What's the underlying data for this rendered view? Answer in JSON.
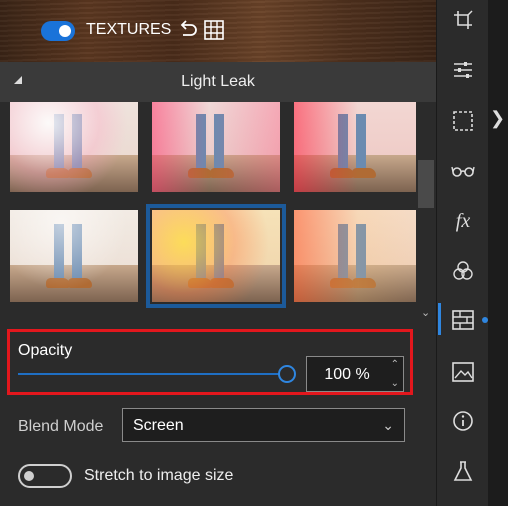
{
  "top": {
    "textures_label": "TEXTURES",
    "textures_on": true
  },
  "section": {
    "title": "Light Leak"
  },
  "thumbnails": [
    {
      "selected": false,
      "tint": "#ffd7e0"
    },
    {
      "selected": false,
      "tint": "#ff6b8a"
    },
    {
      "selected": false,
      "tint": "#ff3b5a"
    },
    {
      "selected": false,
      "tint": "#fff1e0"
    },
    {
      "selected": true,
      "tint": "#ffc24a"
    },
    {
      "selected": false,
      "tint": "#ff5a2a"
    }
  ],
  "opacity": {
    "label": "Opacity",
    "value": "100 %",
    "level": 1.0
  },
  "blend": {
    "label": "Blend Mode",
    "value": "Screen"
  },
  "stretch": {
    "label": "Stretch to image size",
    "on": false
  },
  "sidebar": {
    "icons": [
      "crop-icon",
      "adjust-sliders-icon",
      "selection-icon",
      "glasses-icon",
      "fx-icon",
      "color-circles-icon",
      "texture-icon",
      "image-frame-icon",
      "info-icon",
      "flask-icon"
    ],
    "active": "texture-icon"
  },
  "colors": {
    "accent": "#1a73d9",
    "highlight_border": "#e3171d"
  }
}
